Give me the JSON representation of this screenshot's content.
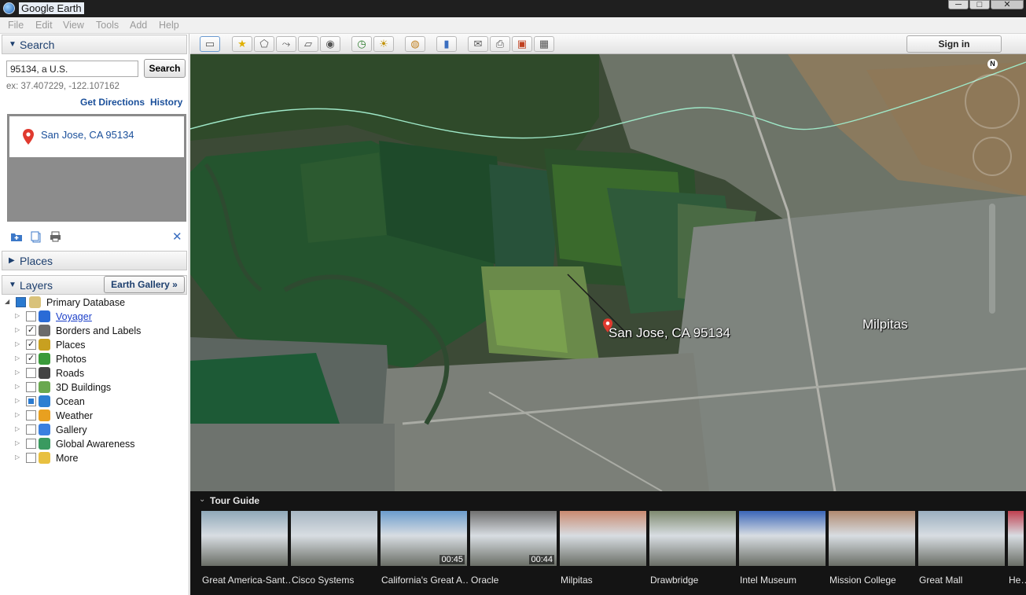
{
  "window": {
    "title": "Google Earth",
    "minimize": "─",
    "maximize": "□",
    "close": "✕"
  },
  "menu": [
    "File",
    "Edit",
    "View",
    "Tools",
    "Add",
    "Help"
  ],
  "search": {
    "panel_title": "Search",
    "input_value": "95134, a U.S.",
    "button_label": "Search",
    "example": "ex: 37.407229, -122.107162",
    "get_directions": "Get Directions",
    "history": "History",
    "result": "San Jose, CA 95134"
  },
  "places": {
    "panel_title": "Places"
  },
  "layers": {
    "panel_title": "Layers",
    "gallery_button": "Earth Gallery »",
    "root": "Primary Database",
    "items": [
      {
        "label": "Voyager",
        "checked": false,
        "icon": "voyager-icon",
        "color": "#2a6bd6"
      },
      {
        "label": "Borders and Labels",
        "checked": true,
        "icon": "flags-icon",
        "color": "#6b6b6b"
      },
      {
        "label": "Places",
        "checked": true,
        "icon": "places-icon",
        "color": "#c8a020"
      },
      {
        "label": "Photos",
        "checked": true,
        "icon": "photos-icon",
        "color": "#3a9a3a"
      },
      {
        "label": "Roads",
        "checked": false,
        "icon": "roads-icon",
        "color": "#444444"
      },
      {
        "label": "3D Buildings",
        "checked": false,
        "icon": "buildings-icon",
        "color": "#6aa84f"
      },
      {
        "label": "Ocean",
        "checked": "partial",
        "icon": "ocean-icon",
        "color": "#2d7fd2"
      },
      {
        "label": "Weather",
        "checked": false,
        "icon": "weather-icon",
        "color": "#e8a020"
      },
      {
        "label": "Gallery",
        "checked": false,
        "icon": "gallery-icon",
        "color": "#3a7fe0"
      },
      {
        "label": "Global Awareness",
        "checked": false,
        "icon": "globe-icon",
        "color": "#3a9a60"
      },
      {
        "label": "More",
        "checked": false,
        "icon": "more-icon",
        "color": "#e8c040"
      }
    ]
  },
  "toolbar": {
    "sign_in": "Sign in"
  },
  "map": {
    "place_label": "San Jose, CA 95134",
    "city_label": "Milpitas",
    "compass": "N"
  },
  "tour": {
    "title": "Tour Guide",
    "items": [
      {
        "label": "Great America-Sant…",
        "duration": "",
        "color": "#8fa8b8"
      },
      {
        "label": "Cisco Systems",
        "duration": "",
        "color": "#a7b6c2"
      },
      {
        "label": "California's Great A…",
        "duration": "00:45",
        "color": "#6b9ccc"
      },
      {
        "label": "Oracle",
        "duration": "00:44",
        "color": "#707070"
      },
      {
        "label": "Milpitas",
        "duration": "",
        "color": "#c98a70"
      },
      {
        "label": "Drawbridge",
        "duration": "",
        "color": "#7f8b70"
      },
      {
        "label": "Intel Museum",
        "duration": "",
        "color": "#3a66b8"
      },
      {
        "label": "Mission College",
        "duration": "",
        "color": "#b08a70"
      },
      {
        "label": "Great Mall",
        "duration": "",
        "color": "#9aaebf"
      },
      {
        "label": "He…",
        "duration": "",
        "color": "#c04050"
      }
    ]
  }
}
